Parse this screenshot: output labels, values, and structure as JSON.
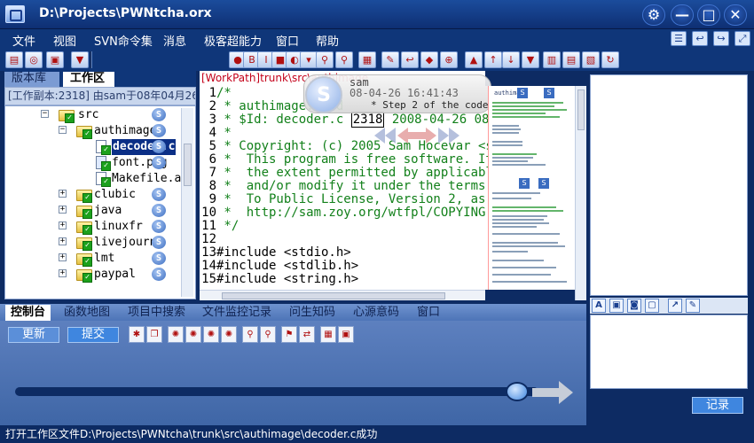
{
  "window": {
    "title": "D:\\Projects\\PWNtcha.orx",
    "buttons": {
      "settings": "⚙",
      "minimize": "—",
      "maximize": "□",
      "close": "✕"
    }
  },
  "menu": [
    "文件",
    "视图",
    "SVN命令集",
    "消息",
    "极客超能力",
    "窗口",
    "帮助"
  ],
  "left": {
    "tabs": [
      "版本库",
      "工作区"
    ],
    "repo_info": "[工作副本:2318] 由sam于08年04月26...",
    "tree": [
      {
        "label": "src",
        "level": 0,
        "type": "folder",
        "expanded": true
      },
      {
        "label": "authimage",
        "level": 1,
        "type": "folder",
        "expanded": true
      },
      {
        "label": "decoder.c",
        "level": 2,
        "type": "file",
        "selected": true
      },
      {
        "label": "font.png",
        "level": 2,
        "type": "file"
      },
      {
        "label": "Makefile.a",
        "level": 2,
        "type": "file"
      },
      {
        "label": "clubic",
        "level": 1,
        "type": "folder"
      },
      {
        "label": "java",
        "level": 1,
        "type": "folder"
      },
      {
        "label": "linuxfr",
        "level": 1,
        "type": "folder"
      },
      {
        "label": "livejourna",
        "level": 1,
        "type": "folder"
      },
      {
        "label": "lmt",
        "level": 1,
        "type": "folder"
      },
      {
        "label": "paypal",
        "level": 1,
        "type": "folder"
      }
    ]
  },
  "editor": {
    "path": "[WorkPath]trunk\\src\\authimage",
    "lines": [
      {
        "n": "1",
        "text": "/*"
      },
      {
        "n": "2",
        "text": " * authimage.c: d"
      },
      {
        "n": "3",
        "text": " * $Id: decoder.c 2318 2008-04-26 08:4"
      },
      {
        "n": "4",
        "text": " *"
      },
      {
        "n": "5",
        "text": " * Copyright: (c) 2005 Sam Hocevar <sa"
      },
      {
        "n": "6",
        "text": " *  This program is free software. It"
      },
      {
        "n": "7",
        "text": " *  the extent permitted by applicable"
      },
      {
        "n": "8",
        "text": " *  and/or modify it under the terms o"
      },
      {
        "n": "9",
        "text": " *  To Public License, Version 2, as p"
      },
      {
        "n": "10",
        "text": " *  http://sam.zoy.org/wtfpl/COPYING f"
      },
      {
        "n": "11",
        "text": " */"
      },
      {
        "n": "12",
        "text": ""
      },
      {
        "n": "13",
        "text": "#include <stdio.h>"
      },
      {
        "n": "14",
        "text": "#include <stdlib.h>"
      },
      {
        "n": "15",
        "text": "#include <string.h>"
      }
    ],
    "popup": {
      "user": "sam",
      "date": "08-04-26 16:41:43",
      "message": "* Step 2 of the code reor",
      "avatar": "S"
    }
  },
  "minimap": {
    "head": "authimage"
  },
  "bottom": {
    "tabs": [
      "控制台",
      "函数地图",
      "项目中搜索",
      "文件监控记录",
      "问生知码",
      "心源意码",
      "窗口"
    ],
    "update_label": "更新",
    "commit_label": "提交",
    "slider_level": 0.96
  },
  "right": {
    "record_label": "记录",
    "tools": [
      "A",
      "▣",
      "◙",
      "▢",
      "↗",
      "✎"
    ]
  },
  "status": {
    "text": "打开工作区文件D:\\Projects\\PWNtcha\\trunk\\src\\authimage\\decoder.c成功"
  },
  "colors": {
    "accent": "#3f86df",
    "titlebar": "#1b4c9c",
    "code_comment": "#12801a",
    "path_red": "#c4001a"
  }
}
